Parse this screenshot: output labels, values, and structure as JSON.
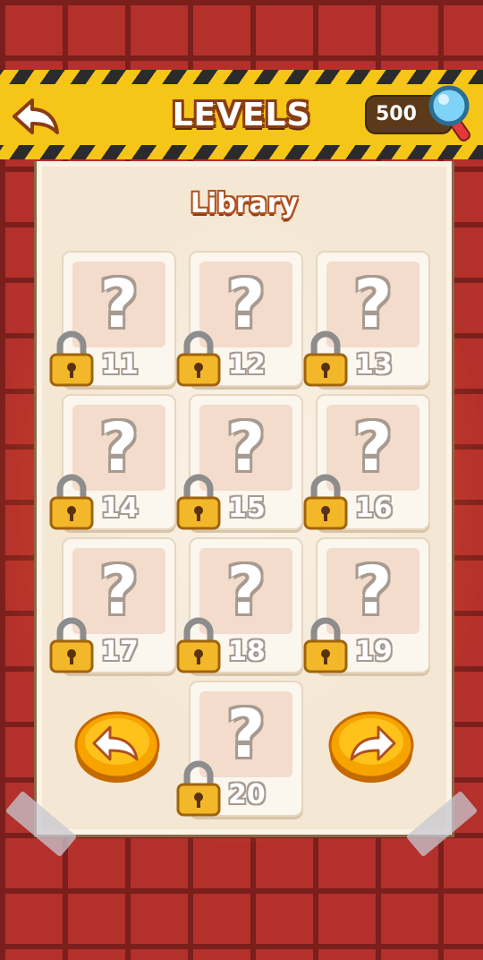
{
  "header": {
    "title": "LEVELS",
    "back_icon": "back-arrow-icon",
    "coins": "500",
    "coin_icon": "magnifier-icon"
  },
  "panel": {
    "title": "Library"
  },
  "levels": [
    {
      "number": "11",
      "label": "?",
      "locked": true
    },
    {
      "number": "12",
      "label": "?",
      "locked": true
    },
    {
      "number": "13",
      "label": "?",
      "locked": true
    },
    {
      "number": "14",
      "label": "?",
      "locked": true
    },
    {
      "number": "15",
      "label": "?",
      "locked": true
    },
    {
      "number": "16",
      "label": "?",
      "locked": true
    },
    {
      "number": "17",
      "label": "?",
      "locked": true
    },
    {
      "number": "18",
      "label": "?",
      "locked": true
    },
    {
      "number": "19",
      "label": "?",
      "locked": true
    },
    {
      "number": "20",
      "label": "?",
      "locked": true
    }
  ],
  "navigation": {
    "prev_icon": "prev-page-icon",
    "next_icon": "next-page-icon"
  },
  "colors": {
    "brick": "#b3302b",
    "hazard_yellow": "#f5c518",
    "panel": "#f4e7d3",
    "nav_button": "#f7a400"
  }
}
